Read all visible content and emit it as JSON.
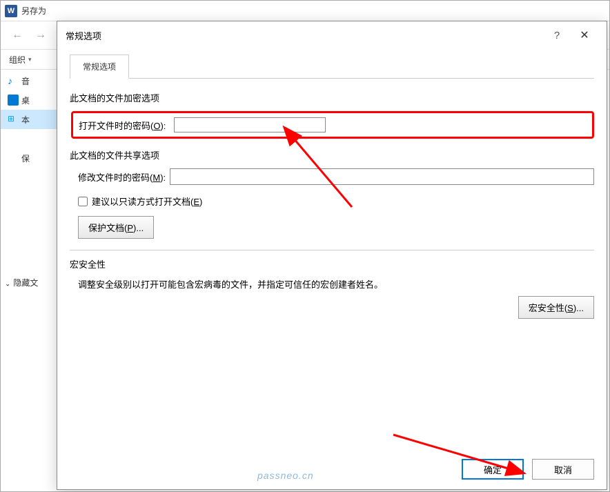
{
  "bg": {
    "title": "另存为",
    "organize": "组织",
    "sidebar": {
      "music": "音",
      "desktop": "桌",
      "pc": "本",
      "save": "保"
    },
    "hidden": "隐藏文"
  },
  "dialog": {
    "title": "常规选项",
    "help": "?",
    "close": "✕",
    "tab": "常规选项",
    "section_encrypt": "此文档的文件加密选项",
    "open_pwd_label_pre": "打开文件时的密码(",
    "open_pwd_key": "O",
    "open_pwd_label_post": "):",
    "section_share": "此文档的文件共享选项",
    "modify_pwd_label_pre": "修改文件时的密码(",
    "modify_pwd_key": "M",
    "modify_pwd_label_post": "):",
    "readonly_pre": "建议以只读方式打开文档(",
    "readonly_key": "E",
    "readonly_post": ")",
    "protect_pre": "保护文档(",
    "protect_key": "P",
    "protect_post": ")...",
    "section_macro": "宏安全性",
    "macro_desc": "调整安全级别以打开可能包含宏病毒的文件，并指定可信任的宏创建者姓名。",
    "macro_btn_pre": "宏安全性(",
    "macro_btn_key": "S",
    "macro_btn_post": ")...",
    "ok": "确定",
    "cancel": "取消"
  },
  "watermark": "passneo.cn"
}
